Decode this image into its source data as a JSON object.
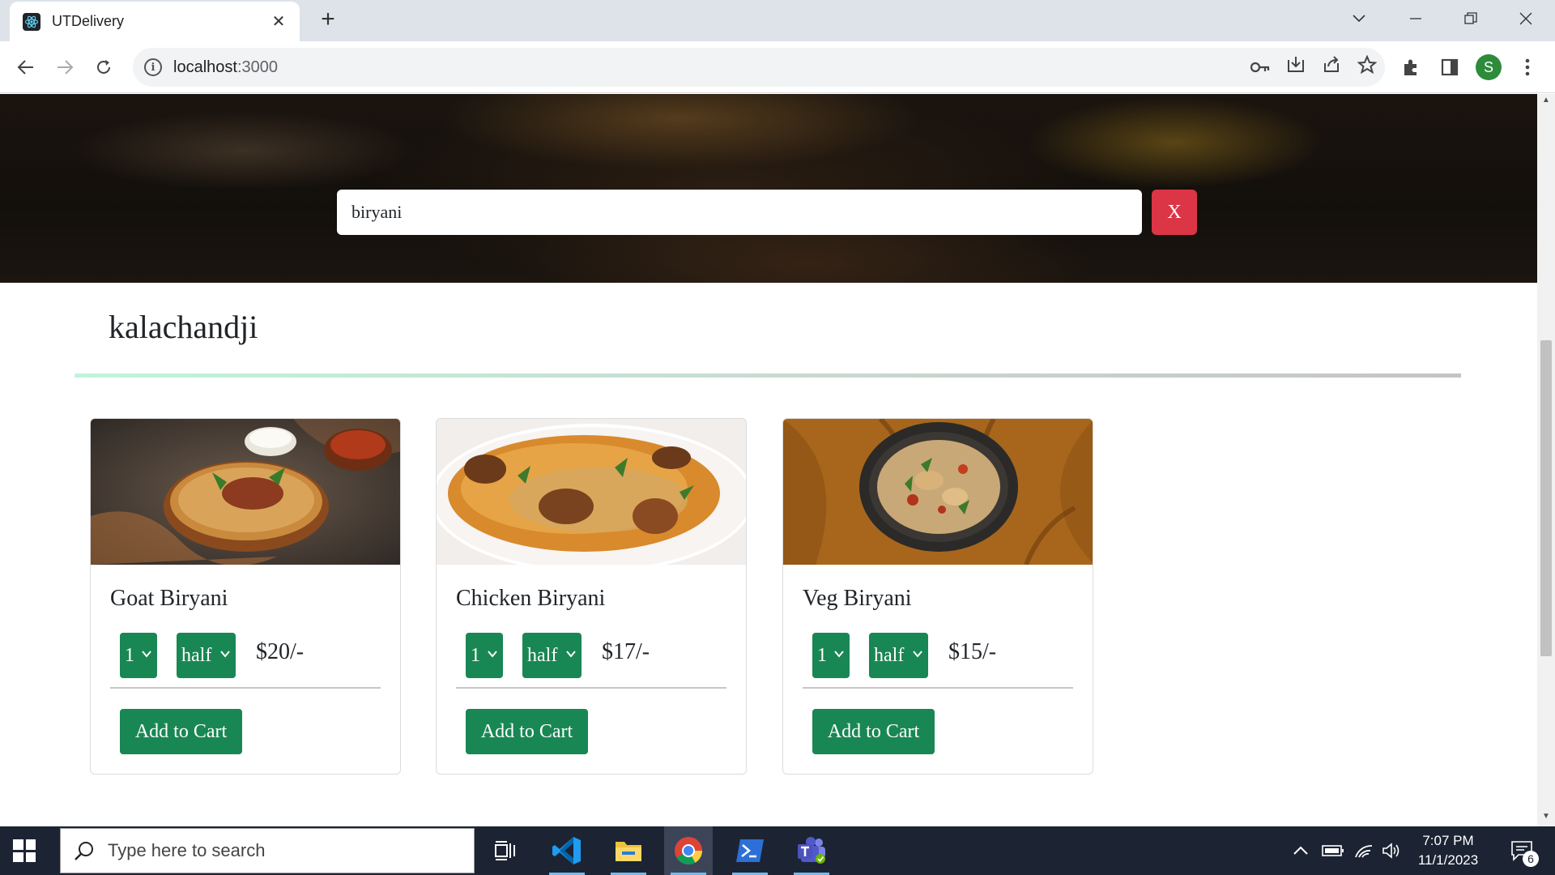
{
  "browser": {
    "tab_title": "UTDelivery",
    "tab_close": "✕",
    "new_tab": "+",
    "url_host": "localhost",
    "url_port": ":3000",
    "profile_initial": "S"
  },
  "page": {
    "search": {
      "value": "biryani",
      "clear_label": "X"
    },
    "restaurant": "kalachandji",
    "items": [
      {
        "name": "Goat Biryani",
        "qty": "1",
        "size": "half",
        "price": "$20/-",
        "add_label": "Add to Cart"
      },
      {
        "name": "Chicken Biryani",
        "qty": "1",
        "size": "half",
        "price": "$17/-",
        "add_label": "Add to Cart"
      },
      {
        "name": "Veg Biryani",
        "qty": "1",
        "size": "half",
        "price": "$15/-",
        "add_label": "Add to Cart"
      }
    ],
    "colors": {
      "accent": "#198754",
      "danger": "#dc3545"
    }
  },
  "taskbar": {
    "search_placeholder": "Type here to search",
    "time": "7:07 PM",
    "date": "11/1/2023",
    "notification_count": "6",
    "apps": [
      "task-view-icon",
      "vscode-icon",
      "file-explorer-icon",
      "chrome-icon",
      "powershell-icon",
      "teams-icon"
    ]
  }
}
